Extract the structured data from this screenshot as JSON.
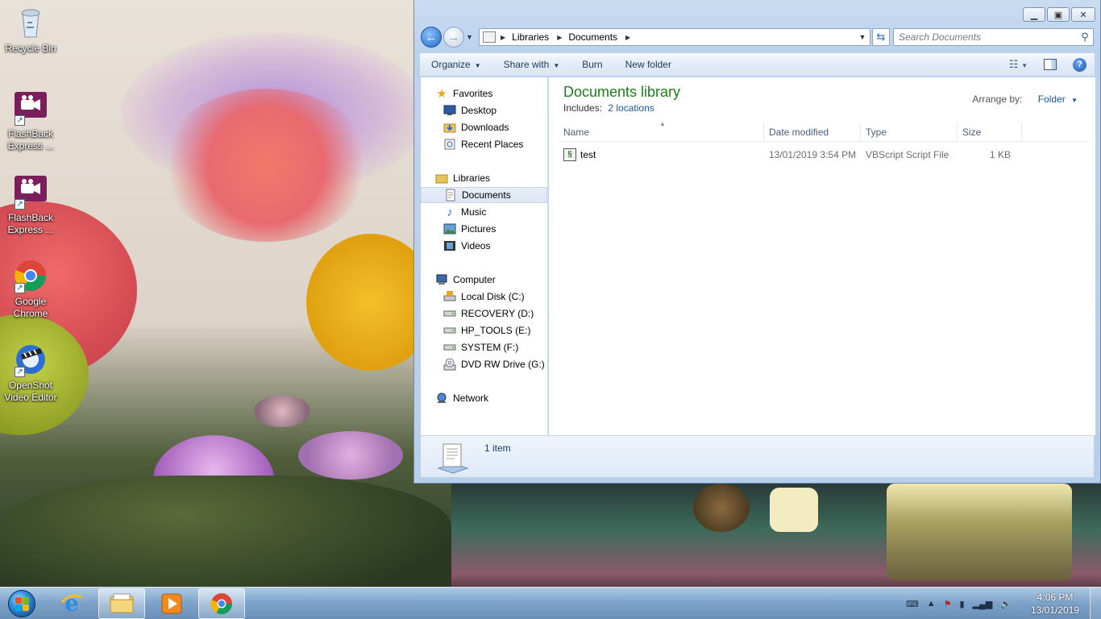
{
  "desktop": {
    "icons": [
      {
        "label": "Recycle Bin",
        "icon": "recycle-bin-icon"
      },
      {
        "label": "FlashBack Express ...",
        "icon": "flashback-icon"
      },
      {
        "label": "FlashBack Express ...",
        "icon": "flashback-icon"
      },
      {
        "label": "Google Chrome",
        "icon": "chrome-icon"
      },
      {
        "label": "OpenShot Video Editor",
        "icon": "openshot-icon"
      }
    ]
  },
  "window": {
    "address": {
      "crumbs": [
        "Libraries",
        "Documents"
      ]
    },
    "search": {
      "placeholder": "Search Documents"
    },
    "toolbar": {
      "organize": "Organize",
      "share_with": "Share with",
      "burn": "Burn",
      "new_folder": "New folder"
    },
    "nav": {
      "favorites": "Favorites",
      "desktop": "Desktop",
      "downloads": "Downloads",
      "recent_places": "Recent Places",
      "libraries": "Libraries",
      "documents": "Documents",
      "music": "Music",
      "pictures": "Pictures",
      "videos": "Videos",
      "computer": "Computer",
      "local_disk": "Local Disk (C:)",
      "recovery": "RECOVERY (D:)",
      "hp_tools": "HP_TOOLS (E:)",
      "system": "SYSTEM (F:)",
      "dvd": "DVD RW Drive (G:) G",
      "network": "Network"
    },
    "library": {
      "title": "Documents library",
      "includes_label": "Includes:",
      "includes_link": "2 locations",
      "arrange_label": "Arrange by:",
      "arrange_value": "Folder"
    },
    "columns": {
      "name": "Name",
      "date": "Date modified",
      "type": "Type",
      "size": "Size"
    },
    "files": [
      {
        "name": "test",
        "date": "13/01/2019 3:54 PM",
        "type": "VBScript Script File",
        "size": "1 KB"
      }
    ],
    "status": {
      "count": "1 item"
    }
  },
  "taskbar": {
    "clock_time": "4:06 PM",
    "clock_date": "13/01/2019"
  },
  "colors": {
    "library_title": "#1e7b1e",
    "link": "#1a55a6",
    "taskbar": "#7aa0c8"
  }
}
